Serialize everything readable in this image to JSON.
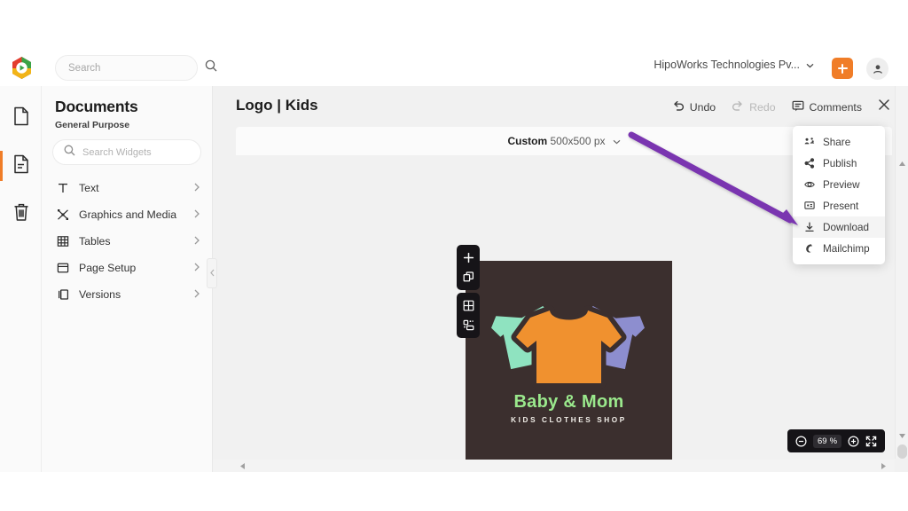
{
  "topbar": {
    "brand_icon": "zoho-hexagon-logo",
    "search": {
      "placeholder": "Search",
      "value": "",
      "icon": "search-icon"
    },
    "org_name": "HipoWorks Technologies Pv...",
    "org_chevron": "chevron-down-icon",
    "add_button_icon": "plus-icon",
    "add_button_color": "#f07d28",
    "avatar_icon": "user-avatar-icon"
  },
  "rail": {
    "items": [
      {
        "name": "pages",
        "icon": "blank-page-icon",
        "active": false
      },
      {
        "name": "document",
        "icon": "document-lines-icon",
        "active": true
      },
      {
        "name": "trash",
        "icon": "trash-icon",
        "active": false
      }
    ],
    "active_accent": "#f07d28"
  },
  "panel": {
    "title": "Documents",
    "subtitle": "General Purpose",
    "search": {
      "placeholder": "Search Widgets",
      "value": "",
      "icon": "search-icon"
    },
    "widgets": [
      {
        "label": "Text",
        "icon": "text-t-icon",
        "chevron": "chevron-right-icon"
      },
      {
        "label": "Graphics and Media",
        "icon": "graphics-media-icon",
        "chevron": "chevron-right-icon"
      },
      {
        "label": "Tables",
        "icon": "table-grid-icon",
        "chevron": "chevron-right-icon"
      },
      {
        "label": "Page Setup",
        "icon": "page-setup-icon",
        "chevron": "chevron-right-icon"
      },
      {
        "label": "Versions",
        "icon": "versions-layers-icon",
        "chevron": "chevron-right-icon"
      }
    ],
    "collapse_icon": "chevron-left-icon"
  },
  "editor": {
    "doc_title": "Logo | Kids",
    "actions": [
      {
        "label": "Undo",
        "icon": "undo-arrow-icon",
        "disabled": false
      },
      {
        "label": "Redo",
        "icon": "redo-arrow-icon",
        "disabled": true
      },
      {
        "label": "Comments",
        "icon": "comment-bubble-icon",
        "disabled": false
      }
    ],
    "close_icon": "close-x-icon",
    "size_preset": "Custom",
    "size_value": "500x500 px",
    "size_chevron": "chevron-down-icon",
    "canvas_bg": "#f1f1f1"
  },
  "mini_toolbars": [
    {
      "name": "add-tools",
      "buttons": [
        {
          "icon": "plus-icon"
        },
        {
          "icon": "duplicate-page-icon"
        }
      ]
    },
    {
      "name": "layout-tools",
      "buttons": [
        {
          "icon": "grid-icon"
        },
        {
          "icon": "layout-blocks-icon"
        }
      ]
    }
  ],
  "artwork": {
    "background": "#3b2f2e",
    "brand_name": "Baby & Mom",
    "tagline": "KIDS CLOTHES SHOP",
    "name_color": "#9ae88c",
    "tagline_color": "#f2efe9",
    "shirts": [
      {
        "name": "shirt-left",
        "color": "#8fe3c0"
      },
      {
        "name": "shirt-center",
        "color": "#f0912f"
      },
      {
        "name": "shirt-right",
        "color": "#8d8ecf"
      }
    ]
  },
  "menu": {
    "items": [
      {
        "label": "Share",
        "icon": "share-people-icon",
        "highlighted": false
      },
      {
        "label": "Publish",
        "icon": "publish-share-node-icon",
        "highlighted": false
      },
      {
        "label": "Preview",
        "icon": "eye-preview-icon",
        "highlighted": false
      },
      {
        "label": "Present",
        "icon": "presentation-screen-icon",
        "highlighted": false
      },
      {
        "label": "Download",
        "icon": "download-arrow-icon",
        "highlighted": true
      },
      {
        "label": "Mailchimp",
        "icon": "mailchimp-icon",
        "highlighted": false
      }
    ]
  },
  "annotation": {
    "type": "arrow",
    "color": "#7a35b0",
    "points_to": "Download"
  },
  "zoom_control": {
    "minus_icon": "zoom-out-circle-icon",
    "value": "69",
    "unit": "%",
    "plus_icon": "zoom-in-circle-icon",
    "fullscreen_icon": "fullscreen-expand-icon"
  },
  "scrollbars": {
    "vertical": {
      "up_icon": "caret-up-icon",
      "down_icon": "caret-down-icon"
    },
    "horizontal": {
      "left_icon": "caret-left-icon",
      "right_icon": "caret-right-icon"
    }
  }
}
